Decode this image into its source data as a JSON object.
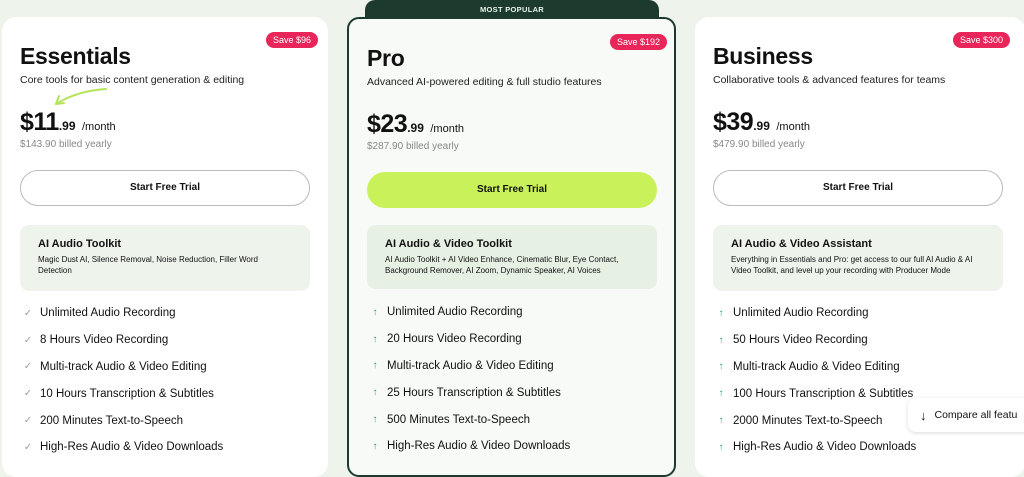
{
  "banner": {
    "label": "MOST POPULAR"
  },
  "plans": [
    {
      "name": "Essentials",
      "save_badge": "Save $96",
      "tagline": "Core tools for basic content generation & editing",
      "price_main": "$11",
      "price_cents": ".99",
      "price_period": "/month",
      "billed_amount": "$143.90",
      "billed_label": "billed yearly",
      "cta_label": "Start Free Trial",
      "toolkit_title": "AI Audio Toolkit",
      "toolkit_desc": "Magic Dust AI, Silence Removal, Noise Reduction, Filler Word Detection",
      "features": [
        "Unlimited Audio Recording",
        "8 Hours Video Recording",
        "Multi-track Audio & Video Editing",
        "10 Hours Transcription & Subtitles",
        "200 Minutes Text-to-Speech",
        "High-Res Audio & Video Downloads"
      ]
    },
    {
      "name": "Pro",
      "save_badge": "Save $192",
      "tagline": "Advanced AI-powered editing & full studio features",
      "price_main": "$23",
      "price_cents": ".99",
      "price_period": "/month",
      "billed_amount": "$287.90",
      "billed_label": "billed yearly",
      "cta_label": "Start Free Trial",
      "toolkit_title": "AI Audio & Video Toolkit",
      "toolkit_desc": "AI Audio Toolkit + AI Video Enhance, Cinematic Blur, Eye Contact, Background Remover, AI Zoom, Dynamic Speaker, AI Voices",
      "features": [
        "Unlimited Audio Recording",
        "20 Hours Video Recording",
        "Multi-track Audio & Video Editing",
        "25 Hours Transcription & Subtitles",
        "500 Minutes Text-to-Speech",
        "High-Res Audio & Video Downloads"
      ]
    },
    {
      "name": "Business",
      "save_badge": "Save $300",
      "tagline": "Collaborative tools & advanced features for teams",
      "price_main": "$39",
      "price_cents": ".99",
      "price_period": "/month",
      "billed_amount": "$479.90",
      "billed_label": "billed yearly",
      "cta_label": "Start Free Trial",
      "toolkit_title": "AI Audio & Video Assistant",
      "toolkit_desc": "Everything in Essentials and Pro: get access to our full AI Audio & AI Video Toolkit, and level up your recording with Producer Mode",
      "features": [
        "Unlimited Audio Recording",
        "50 Hours Video Recording",
        "Multi-track Audio & Video Editing",
        "100 Hours Transcription & Subtitles",
        "2000 Minutes Text-to-Speech",
        "High-Res Audio & Video Downloads"
      ]
    }
  ],
  "compare": {
    "label": "Compare all featu",
    "icon": "arrow-down-icon"
  },
  "colors": {
    "accent_green": "#c9f25a",
    "badge_pink": "#e8265a",
    "dark_green": "#1c3b2e",
    "check_teal": "#2e9c7a"
  }
}
